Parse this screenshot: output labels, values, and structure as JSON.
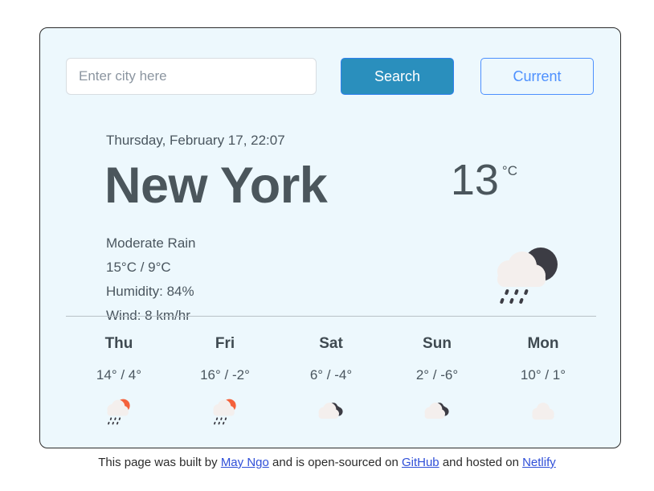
{
  "search": {
    "input_value": "",
    "placeholder": "Enter city here",
    "search_label": "Search",
    "current_label": "Current"
  },
  "current": {
    "date": "Thursday, February 17, 22:07",
    "city": "New York",
    "temperature": "13",
    "unit": "°C",
    "condition": "Moderate Rain",
    "high_low": "15°C / 9°C",
    "humidity": "Humidity: 84%",
    "wind": "Wind: 8 km/hr",
    "icon": "cloud-moon-rain-icon"
  },
  "forecast": [
    {
      "day": "Thu",
      "temps": "14° / 4°",
      "icon": "sun-cloud-rain-icon"
    },
    {
      "day": "Fri",
      "temps": "16° / -2°",
      "icon": "sun-cloud-rain-icon"
    },
    {
      "day": "Sat",
      "temps": "6° / -4°",
      "icon": "cloud-dark-cloud-icon"
    },
    {
      "day": "Sun",
      "temps": "2° / -6°",
      "icon": "cloud-dark-cloud-icon"
    },
    {
      "day": "Mon",
      "temps": "10° / 1°",
      "icon": "cloud-icon"
    }
  ],
  "footer": {
    "text_1": "This page was built by ",
    "link_1": "May Ngo",
    "text_2": " and is open-sourced on ",
    "link_2": "GitHub",
    "text_3": " and hosted on ",
    "link_3": "Netlify"
  },
  "colors": {
    "card_background": "#edf8fd",
    "card_border": "#2b2b2b",
    "search_button": "#2a8fbd",
    "current_button_accent": "#4d90fe",
    "text": "#4a565f",
    "link": "#2f4fd8",
    "cloud_light": "#f4efed",
    "cloud_dark": "#3c3c44",
    "sun": "#f4613b",
    "rain": "#3c3c44"
  }
}
